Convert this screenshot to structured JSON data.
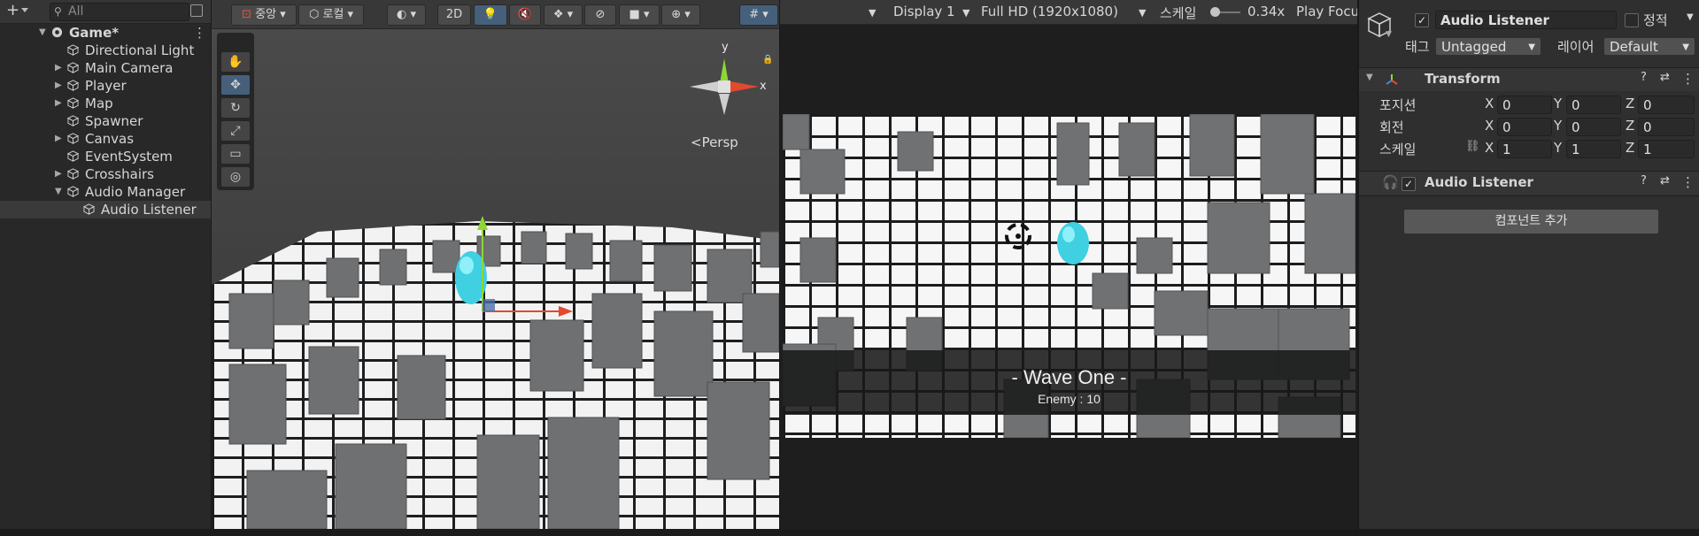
{
  "hierarchy": {
    "add_label": "+",
    "search_placeholder": "All",
    "scene_name": "Game*",
    "items": [
      {
        "label": "Directional Light",
        "expandable": false,
        "indent": 1
      },
      {
        "label": "Main Camera",
        "expandable": true,
        "indent": 1
      },
      {
        "label": "Player",
        "expandable": true,
        "indent": 1
      },
      {
        "label": "Map",
        "expandable": true,
        "indent": 1
      },
      {
        "label": "Spawner",
        "expandable": false,
        "indent": 1
      },
      {
        "label": "Canvas",
        "expandable": true,
        "indent": 1
      },
      {
        "label": "EventSystem",
        "expandable": false,
        "indent": 1
      },
      {
        "label": "Crosshairs",
        "expandable": true,
        "indent": 1
      },
      {
        "label": "Audio Manager",
        "expandable": true,
        "expanded": true,
        "indent": 1
      },
      {
        "label": "Audio Listener",
        "expandable": false,
        "indent": 2,
        "selected": true
      }
    ]
  },
  "scene_toolbar": {
    "pivot_label": "중앙",
    "space_label": "로컬",
    "mode_2d": "2D"
  },
  "scene_view": {
    "gizmo_y": "y",
    "gizmo_x": "x",
    "persp_label": "<Persp"
  },
  "game_toolbar": {
    "display": "Display 1",
    "resolution": "Full HD (1920x1080)",
    "scale_label": "스케일",
    "scale_value": "0.34x",
    "play_focus": "Play Focu"
  },
  "game_view": {
    "wave_title": "- Wave One -",
    "enemy_text": "Enemy : 10"
  },
  "inspector": {
    "object_name": "Audio Listener",
    "static_label": "정적",
    "tag_label": "태그",
    "tag_value": "Untagged",
    "layer_label": "레이어",
    "layer_value": "Default",
    "transform_title": "Transform",
    "position_label": "포지션",
    "rotation_label": "회전",
    "scale_label": "스케일",
    "position": {
      "x": "0",
      "y": "0",
      "z": "0"
    },
    "rotation": {
      "x": "0",
      "y": "0",
      "z": "0"
    },
    "scale": {
      "x": "1",
      "y": "1",
      "z": "1"
    },
    "axis_x": "X",
    "axis_y": "Y",
    "axis_z": "Z",
    "audio_title": "Audio Listener",
    "add_component": "컴포넌트 추가"
  },
  "colors": {
    "accent_blue": "#46607c",
    "panel_bg": "#282828",
    "inspector_bg": "#2f2f2f"
  }
}
